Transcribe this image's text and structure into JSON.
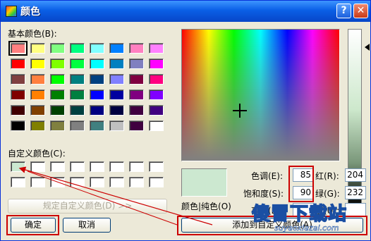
{
  "window": {
    "title": "颜色",
    "help_label": "?",
    "close_label": "✕"
  },
  "basic_colors": {
    "label": "基本颜色(B):",
    "rows": [
      [
        "#ff8080",
        "#ffff80",
        "#80ff80",
        "#00ff80",
        "#80ffff",
        "#0080ff",
        "#ff80c0",
        "#ff80ff"
      ],
      [
        "#ff0000",
        "#ffff00",
        "#80ff00",
        "#00ff40",
        "#00ffff",
        "#0080c0",
        "#8080c0",
        "#ff00ff"
      ],
      [
        "#804040",
        "#ff8040",
        "#00ff00",
        "#008080",
        "#004080",
        "#8080ff",
        "#800040",
        "#ff0080"
      ],
      [
        "#800000",
        "#ff8000",
        "#008000",
        "#008040",
        "#0000ff",
        "#0000a0",
        "#800080",
        "#8000ff"
      ],
      [
        "#400000",
        "#804000",
        "#004000",
        "#004040",
        "#000080",
        "#000040",
        "#400040",
        "#400080"
      ],
      [
        "#000000",
        "#808000",
        "#808040",
        "#808080",
        "#408080",
        "#c0c0c0",
        "#400040",
        "#ffffff"
      ]
    ]
  },
  "custom_colors": {
    "label": "自定义颜色(C):",
    "rows": [
      [
        "#cce8d0",
        "#ffffff",
        "#ffffff",
        "#ffffff",
        "#ffffff",
        "#ffffff",
        "#ffffff",
        "#ffffff"
      ],
      [
        "#ffffff",
        "#ffffff",
        "#ffffff",
        "#ffffff",
        "#ffffff",
        "#ffffff",
        "#ffffff",
        "#ffffff"
      ]
    ]
  },
  "buttons": {
    "define_custom": "规定自定义颜色(D) >>",
    "ok": "确定",
    "cancel": "取消",
    "add_custom": "添加到自定义颜色(A)"
  },
  "fields": {
    "hue_label": "色调(E):",
    "hue_value": "85",
    "sat_label": "饱和度(S):",
    "sat_value": "90",
    "lum_label": "亮度(L):",
    "lum_value": "",
    "red_label": "红(R):",
    "red_value": "204",
    "green_label": "绿(G):",
    "green_value": "232",
    "blue_label": "蓝(U):",
    "blue_value": ""
  },
  "preview": {
    "label": "颜色|纯色(O)",
    "color": "#cce8d0"
  },
  "watermark": {
    "text": "傻冒下载站",
    "url": "suyaoxiazai.com"
  },
  "accent_colors": {
    "title_bar": "#0a5fe6",
    "annotation": "#cc0000"
  }
}
